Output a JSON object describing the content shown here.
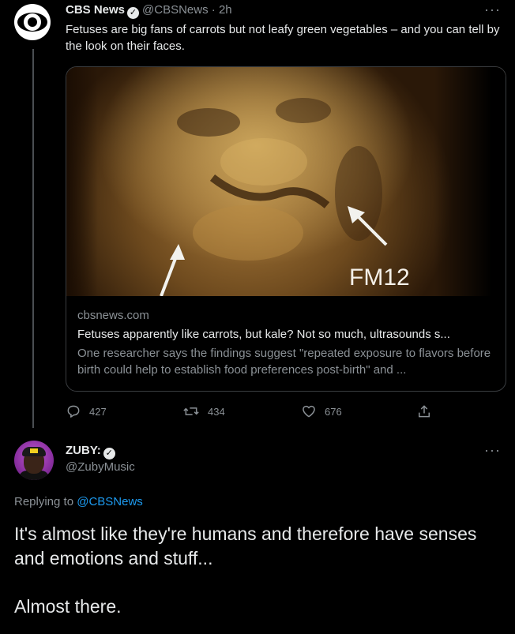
{
  "tweet": {
    "name": "CBS News",
    "handle": "@CBSNews · 2h",
    "text": "Fetuses are big fans of carrots but not leafy green vegetables – and you can tell by the look on their faces.",
    "more": "···",
    "card": {
      "image_label": "FM12",
      "domain": "cbsnews.com",
      "title": "Fetuses apparently like carrots, but kale? Not so much, ultrasounds s...",
      "description": "One researcher says the findings suggest \"repeated exposure to flavors before birth could help to establish food preferences post-birth\" and ..."
    },
    "actions": {
      "replies": "427",
      "retweets": "434",
      "likes": "676"
    }
  },
  "reply": {
    "name": "ZUBY:",
    "handle": "@ZubyMusic",
    "more": "···",
    "replying_prefix": "Replying to",
    "replying_to": "@CBSNews",
    "text_line1": "It's almost like they're humans and therefore have senses and emotions and stuff...",
    "text_line2": "Almost there."
  },
  "icons": {
    "cbs": "cbs-eye-logo",
    "verified": "verified-check-icon",
    "reply": "reply-bubble-icon",
    "retweet": "retweet-icon",
    "like": "heart-icon",
    "share": "share-icon"
  },
  "colors": {
    "background": "#000000",
    "text": "#e7e9ea",
    "muted": "#8b9196",
    "link": "#1d9bf0"
  }
}
